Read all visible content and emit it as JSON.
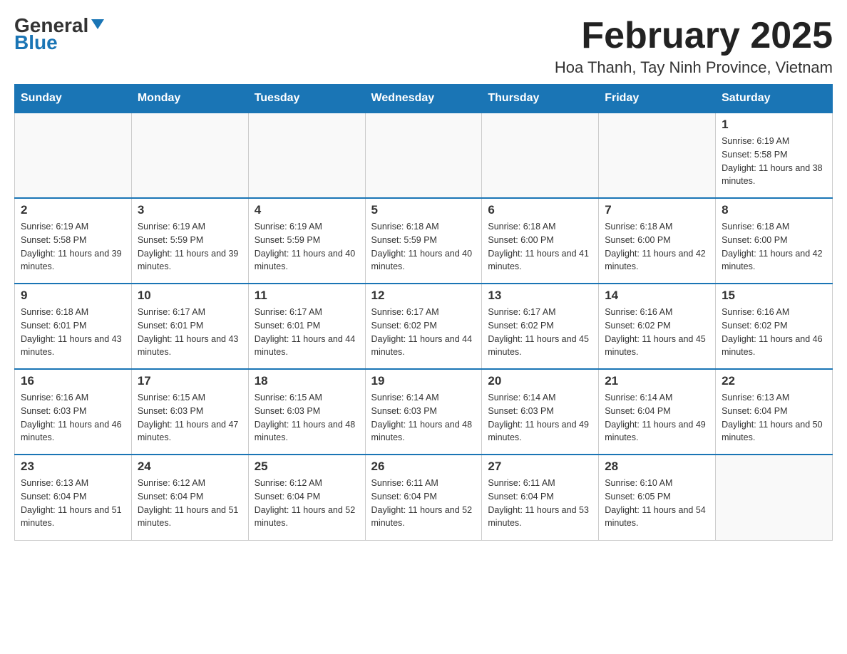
{
  "header": {
    "logo_general": "General",
    "logo_blue": "Blue",
    "title": "February 2025",
    "subtitle": "Hoa Thanh, Tay Ninh Province, Vietnam"
  },
  "days_of_week": [
    "Sunday",
    "Monday",
    "Tuesday",
    "Wednesday",
    "Thursday",
    "Friday",
    "Saturday"
  ],
  "weeks": [
    [
      {
        "day": "",
        "sunrise": "",
        "sunset": "",
        "daylight": ""
      },
      {
        "day": "",
        "sunrise": "",
        "sunset": "",
        "daylight": ""
      },
      {
        "day": "",
        "sunrise": "",
        "sunset": "",
        "daylight": ""
      },
      {
        "day": "",
        "sunrise": "",
        "sunset": "",
        "daylight": ""
      },
      {
        "day": "",
        "sunrise": "",
        "sunset": "",
        "daylight": ""
      },
      {
        "day": "",
        "sunrise": "",
        "sunset": "",
        "daylight": ""
      },
      {
        "day": "1",
        "sunrise": "Sunrise: 6:19 AM",
        "sunset": "Sunset: 5:58 PM",
        "daylight": "Daylight: 11 hours and 38 minutes."
      }
    ],
    [
      {
        "day": "2",
        "sunrise": "Sunrise: 6:19 AM",
        "sunset": "Sunset: 5:58 PM",
        "daylight": "Daylight: 11 hours and 39 minutes."
      },
      {
        "day": "3",
        "sunrise": "Sunrise: 6:19 AM",
        "sunset": "Sunset: 5:59 PM",
        "daylight": "Daylight: 11 hours and 39 minutes."
      },
      {
        "day": "4",
        "sunrise": "Sunrise: 6:19 AM",
        "sunset": "Sunset: 5:59 PM",
        "daylight": "Daylight: 11 hours and 40 minutes."
      },
      {
        "day": "5",
        "sunrise": "Sunrise: 6:18 AM",
        "sunset": "Sunset: 5:59 PM",
        "daylight": "Daylight: 11 hours and 40 minutes."
      },
      {
        "day": "6",
        "sunrise": "Sunrise: 6:18 AM",
        "sunset": "Sunset: 6:00 PM",
        "daylight": "Daylight: 11 hours and 41 minutes."
      },
      {
        "day": "7",
        "sunrise": "Sunrise: 6:18 AM",
        "sunset": "Sunset: 6:00 PM",
        "daylight": "Daylight: 11 hours and 42 minutes."
      },
      {
        "day": "8",
        "sunrise": "Sunrise: 6:18 AM",
        "sunset": "Sunset: 6:00 PM",
        "daylight": "Daylight: 11 hours and 42 minutes."
      }
    ],
    [
      {
        "day": "9",
        "sunrise": "Sunrise: 6:18 AM",
        "sunset": "Sunset: 6:01 PM",
        "daylight": "Daylight: 11 hours and 43 minutes."
      },
      {
        "day": "10",
        "sunrise": "Sunrise: 6:17 AM",
        "sunset": "Sunset: 6:01 PM",
        "daylight": "Daylight: 11 hours and 43 minutes."
      },
      {
        "day": "11",
        "sunrise": "Sunrise: 6:17 AM",
        "sunset": "Sunset: 6:01 PM",
        "daylight": "Daylight: 11 hours and 44 minutes."
      },
      {
        "day": "12",
        "sunrise": "Sunrise: 6:17 AM",
        "sunset": "Sunset: 6:02 PM",
        "daylight": "Daylight: 11 hours and 44 minutes."
      },
      {
        "day": "13",
        "sunrise": "Sunrise: 6:17 AM",
        "sunset": "Sunset: 6:02 PM",
        "daylight": "Daylight: 11 hours and 45 minutes."
      },
      {
        "day": "14",
        "sunrise": "Sunrise: 6:16 AM",
        "sunset": "Sunset: 6:02 PM",
        "daylight": "Daylight: 11 hours and 45 minutes."
      },
      {
        "day": "15",
        "sunrise": "Sunrise: 6:16 AM",
        "sunset": "Sunset: 6:02 PM",
        "daylight": "Daylight: 11 hours and 46 minutes."
      }
    ],
    [
      {
        "day": "16",
        "sunrise": "Sunrise: 6:16 AM",
        "sunset": "Sunset: 6:03 PM",
        "daylight": "Daylight: 11 hours and 46 minutes."
      },
      {
        "day": "17",
        "sunrise": "Sunrise: 6:15 AM",
        "sunset": "Sunset: 6:03 PM",
        "daylight": "Daylight: 11 hours and 47 minutes."
      },
      {
        "day": "18",
        "sunrise": "Sunrise: 6:15 AM",
        "sunset": "Sunset: 6:03 PM",
        "daylight": "Daylight: 11 hours and 48 minutes."
      },
      {
        "day": "19",
        "sunrise": "Sunrise: 6:14 AM",
        "sunset": "Sunset: 6:03 PM",
        "daylight": "Daylight: 11 hours and 48 minutes."
      },
      {
        "day": "20",
        "sunrise": "Sunrise: 6:14 AM",
        "sunset": "Sunset: 6:03 PM",
        "daylight": "Daylight: 11 hours and 49 minutes."
      },
      {
        "day": "21",
        "sunrise": "Sunrise: 6:14 AM",
        "sunset": "Sunset: 6:04 PM",
        "daylight": "Daylight: 11 hours and 49 minutes."
      },
      {
        "day": "22",
        "sunrise": "Sunrise: 6:13 AM",
        "sunset": "Sunset: 6:04 PM",
        "daylight": "Daylight: 11 hours and 50 minutes."
      }
    ],
    [
      {
        "day": "23",
        "sunrise": "Sunrise: 6:13 AM",
        "sunset": "Sunset: 6:04 PM",
        "daylight": "Daylight: 11 hours and 51 minutes."
      },
      {
        "day": "24",
        "sunrise": "Sunrise: 6:12 AM",
        "sunset": "Sunset: 6:04 PM",
        "daylight": "Daylight: 11 hours and 51 minutes."
      },
      {
        "day": "25",
        "sunrise": "Sunrise: 6:12 AM",
        "sunset": "Sunset: 6:04 PM",
        "daylight": "Daylight: 11 hours and 52 minutes."
      },
      {
        "day": "26",
        "sunrise": "Sunrise: 6:11 AM",
        "sunset": "Sunset: 6:04 PM",
        "daylight": "Daylight: 11 hours and 52 minutes."
      },
      {
        "day": "27",
        "sunrise": "Sunrise: 6:11 AM",
        "sunset": "Sunset: 6:04 PM",
        "daylight": "Daylight: 11 hours and 53 minutes."
      },
      {
        "day": "28",
        "sunrise": "Sunrise: 6:10 AM",
        "sunset": "Sunset: 6:05 PM",
        "daylight": "Daylight: 11 hours and 54 minutes."
      },
      {
        "day": "",
        "sunrise": "",
        "sunset": "",
        "daylight": ""
      }
    ]
  ]
}
